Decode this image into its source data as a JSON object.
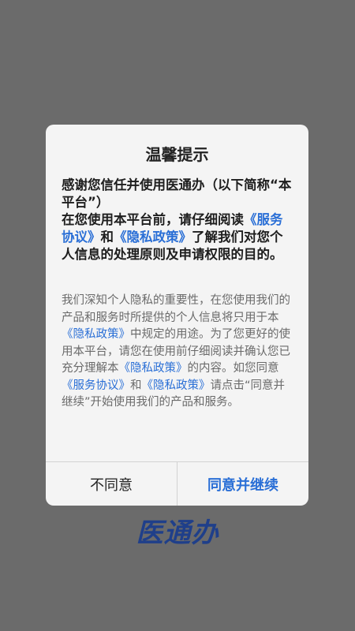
{
  "dialog": {
    "title": "温馨提示",
    "intro": {
      "p1": "感谢您信任并使用医通办（以下简称“本平台”）",
      "p2a": "在您使用本平台前，请仔细阅读",
      "link_service": "《服务协议》",
      "p2b": "和",
      "link_privacy": "《隐私政策》",
      "p2c": "了解我们对您个人信息的处理原则及申请权限的目的。"
    },
    "body": {
      "t1": "我们深知个人隐私的重要性，在您使用我们的产品和服务时所提供的个人信息将只用于本",
      "link_privacy_1": "《隐私政策》",
      "t2": "中规定的用途。为了您更好的使用本平台，请您在使用前仔细阅读并确认您已充分理解本",
      "link_privacy_2": "《隐私政策》",
      "t3": "的内容。如您同意",
      "link_service": "《服务协议》",
      "t4": "和",
      "link_privacy_3": "《隐私政策》",
      "t5": "请点击“同意并继续”开始使用我们的产品和服务。"
    },
    "buttons": {
      "disagree": "不同意",
      "agree": "同意并继续"
    }
  },
  "brand": {
    "logo_text": "医通办"
  },
  "colors": {
    "overlay": "#6b6b6b",
    "dialog_bg": "#f4f4f4",
    "link": "#2a6fd6",
    "brand": "#1f3f8a"
  }
}
